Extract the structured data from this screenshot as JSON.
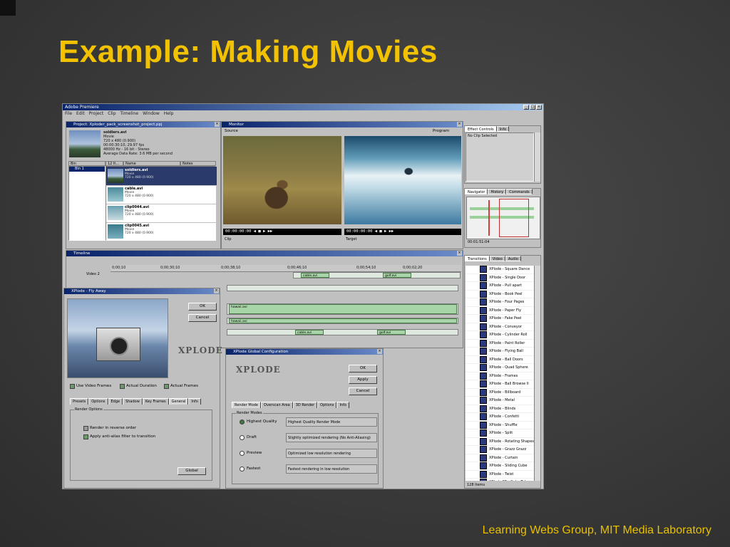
{
  "slide": {
    "title": "Example: Making Movies",
    "footer": "Learning Webs Group, MIT Media Laboratory"
  },
  "app": {
    "title": "Adobe Premiere",
    "menu": [
      "File",
      "Edit",
      "Project",
      "Clip",
      "Timeline",
      "Window",
      "Help"
    ]
  },
  "project": {
    "title": "Project: Xploder_pack_screenshot_project.ppj",
    "info": [
      "soldiers.avi",
      "Movie",
      "720 x 480 (0.900)",
      "00:00:30:10, 29.97 fps",
      "48000 Hz - 16 bit - Stereo",
      "Average Data Rate: 3.6 MB per second"
    ],
    "bin_label": "Bin 1",
    "columns": [
      "Bin",
      "12 It...",
      "Name",
      "Notes"
    ],
    "clips": [
      {
        "name": "soldiers.avi",
        "type": "Movie",
        "size": "720 x 480 (0.900)"
      },
      {
        "name": "cable.avi",
        "type": "Movie",
        "size": "720 x 480 (0.900)"
      },
      {
        "name": "clip0044.avi",
        "type": "Movie",
        "size": "720 x 480 (0.900)"
      },
      {
        "name": "clip0045.avi",
        "type": "Movie",
        "size": "720 x 480 (0.900)"
      }
    ]
  },
  "monitor": {
    "title": "Monitor",
    "source_label": "Source",
    "program_label": "Program",
    "source_tc": "00:00:00:00",
    "program_tc": "00:00:00:00",
    "target_label": "Target",
    "clip_label": "Clip"
  },
  "timeline": {
    "title": "Timeline",
    "ruler": [
      "0;00;10",
      "0;00;30;10",
      "0;00;38;10",
      "0;00;46;10",
      "0;00;54;10",
      "0;00;02;20"
    ],
    "video_track": "Video 2",
    "clips": [
      "cable.avi",
      "golf.avi",
      "hawaii.avi",
      "hawaii.avi",
      "cable.avi",
      "golf.avi"
    ]
  },
  "fly_away": {
    "title": "XPlode - Fly Away",
    "ok": "OK",
    "cancel": "Cancel",
    "checks": [
      "Use Video Frames",
      "Actual Duration",
      "Actual Frames"
    ],
    "tabs": [
      "Presets",
      "Options",
      "Edge",
      "Shadow",
      "Key Frames",
      "General",
      "Info"
    ],
    "group": "Render Options",
    "options": [
      "Render in reverse order",
      "Apply anti-alias filter to transition"
    ],
    "global_button": "Global"
  },
  "config": {
    "title": "XPlode Global Configuration",
    "ok": "OK",
    "apply": "Apply",
    "cancel": "Cancel",
    "tabs": [
      "Render Mode",
      "Overscan Area",
      "3D Render",
      "Options",
      "Info"
    ],
    "group": "Render Modes",
    "modes": [
      {
        "label": "Highest Quality",
        "desc": "Highest Quality Render Mode"
      },
      {
        "label": "Draft",
        "desc": "Slightly optimized rendering (No Anti-Aliasing)"
      },
      {
        "label": "Preview",
        "desc": "Optimized low resolution rendering"
      },
      {
        "label": "Fastest",
        "desc": "Fastest rendering in low resolution"
      }
    ]
  },
  "right": {
    "effect_tabs": [
      "Effect Controls",
      "Info"
    ],
    "no_clip": "No Clip Selected",
    "nav_tabs": [
      "Navigator",
      "History",
      "Commands"
    ],
    "nav_tc": "00:01:51:04",
    "trans_tabs": [
      "Transitions",
      "Video",
      "Audio"
    ],
    "transitions": [
      "XPlode - Square Dance",
      "XPlode - Single Door",
      "XPlode - Pull apart",
      "XPlode - Book Peel",
      "XPlode - Four Pages",
      "XPlode - Paper Fly",
      "XPlode - Fake Peel",
      "XPlode - Conveyor",
      "XPlode - Cylinder Roll",
      "XPlode - Paint Roller",
      "XPlode - Flying Ball",
      "XPlode - Ball Doors",
      "XPlode - Quad Sphere",
      "XPlode - Frames",
      "XPlode - Ball Browse II",
      "XPlode - Billboard",
      "XPlode - Metal",
      "XPlode - Blinds",
      "XPlode - Confetti",
      "XPlode - Shuffle",
      "XPlode - Split",
      "XPlode - Rotating Shapes",
      "XPlode - Grazz Grazz",
      "XPlode - Curtain",
      "XPlode - Sliding Cube",
      "XPlode - Twist",
      "XPlode SE - Cube Tube",
      "XPlode SE - Double Door",
      "XPlode SE - Fly Away"
    ],
    "item_count": "128 Items"
  }
}
